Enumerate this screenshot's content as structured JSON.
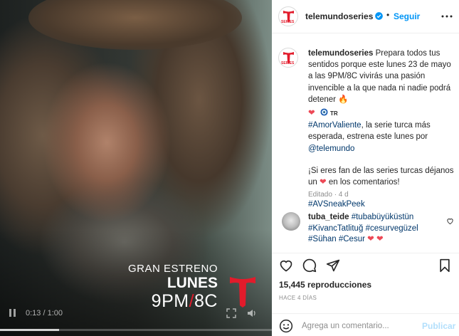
{
  "video": {
    "promo_line1": "GRAN ESTRENO",
    "promo_line2": "LUNES",
    "promo_time_a": "9PM",
    "promo_slash": "/",
    "promo_time_b": "8C",
    "time": "0:13 / 1:00",
    "progress": 0.217
  },
  "header": {
    "username": "telemundoseries",
    "dot": "•",
    "follow_label": "Seguir",
    "avatar_text": "SERIES"
  },
  "caption": {
    "username": "telemundoseries",
    "line1": "Prepara todos tus sentidos porque este lunes 23 de mayo a las 9PM/8C vivirás una pasión invencible a la que nada ni nadie podrá detener",
    "flame": "🔥",
    "heart": "❤",
    "tr_label": "TR",
    "hashtag_main": "#AmorValiente",
    "line2": ", la serie turca más esperada, estrena este lunes por",
    "mention": "@telemundo",
    "line3a": "¡Si eres fan de las series turcas déjanos un",
    "line3b": "en los comentarios!",
    "hashtag_end": "#AVSneakPeek",
    "edited": "Editado · 4 d"
  },
  "comment": {
    "username": "tuba_teide",
    "tags": [
      "#tubabüyüküstün",
      "#KivancTatlituğ",
      "#cesurvegüzel",
      "#Sühan",
      "#Cesur"
    ],
    "hearts": "❤ ❤"
  },
  "stats": {
    "views": "15,445 reproducciones",
    "ago": "HACE 4 DÍAS"
  },
  "add_comment": {
    "placeholder": "Agrega un comentario...",
    "post_label": "Publicar"
  },
  "icons": {
    "colors": {
      "accent": "#0095f6",
      "like": "#ed4956",
      "brand_red": "#e21b2b"
    }
  }
}
